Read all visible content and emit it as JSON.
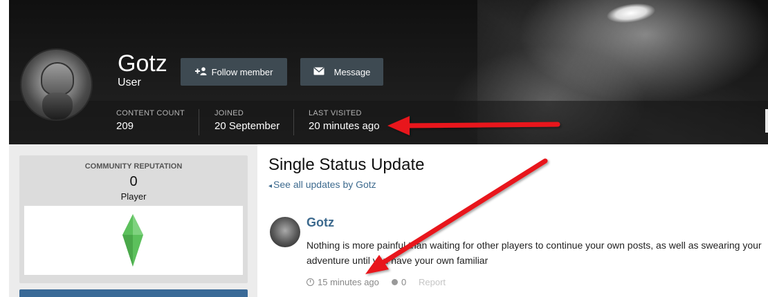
{
  "profile": {
    "name": "Gotz",
    "role": "User",
    "follow_label": "Follow member",
    "message_label": "Message",
    "stats": [
      {
        "label": "CONTENT COUNT",
        "value": "209"
      },
      {
        "label": "JOINED",
        "value": "20 September"
      },
      {
        "label": "LAST VISITED",
        "value": "20 minutes ago"
      }
    ]
  },
  "sidebar": {
    "rep_title": "COMMUNITY REPUTATION",
    "rep_value": "0",
    "rep_level": "Player"
  },
  "main": {
    "title": "Single Status Update",
    "see_all": "See all updates by Gotz",
    "post": {
      "author": "Gotz",
      "body": "Nothing is more painful than waiting for other players to continue your own posts, as well as swearing your adventure until you have your own familiar",
      "time": "15 minutes ago",
      "likes": "0",
      "report": "Report"
    }
  },
  "icons": {
    "follow": "user-plus-icon",
    "message": "envelope-icon",
    "back": "chevron-left-icon",
    "time": "clock-icon",
    "likes": "circle-icon"
  },
  "colors": {
    "link": "#3d6a8e",
    "button": "#3e4a52",
    "annotation": "#e8141a",
    "gem": "#5cc05c"
  }
}
